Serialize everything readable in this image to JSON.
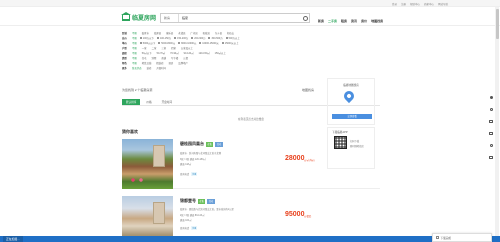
{
  "topbar": {
    "links": [
      "登录",
      "注册",
      "帮助中心",
      "商家中心",
      "网站导航"
    ]
  },
  "header": {
    "logo_text": "临夏房网",
    "search": {
      "scope": "新房",
      "query": "临夏"
    },
    "nav": [
      "新房",
      "二手房",
      "租房",
      "资讯",
      "房价",
      "地图找房"
    ],
    "nav_active": 1
  },
  "filters": {
    "rows": [
      {
        "label": "区域",
        "options": [
          "不限",
          "临夏市",
          "临夏县",
          "康乐县",
          "永靖县",
          "广河县",
          "和政县",
          "东乡县",
          "积石山"
        ]
      },
      {
        "label": "总价",
        "options": [
          "不限",
          "100万以下",
          "100-150万",
          "150-200万",
          "200-300万",
          "300-500万",
          "500万以上"
        ]
      },
      {
        "label": "单价",
        "options": [
          "不限",
          "5000元以下",
          "5000-8000元",
          "8000-10000元",
          "10000-15000元",
          "15000元以上"
        ]
      },
      {
        "label": "户型",
        "options": [
          "不限",
          "一室",
          "二室",
          "三室",
          "四室",
          "五室及以上"
        ]
      },
      {
        "label": "面积",
        "options": [
          "不限",
          "50㎡以下",
          "50-70㎡",
          "70-90㎡",
          "90-120㎡",
          "120-150㎡",
          "150㎡以上"
        ]
      },
      {
        "label": "类型",
        "options": [
          "不限",
          "住宅",
          "别墅",
          "商铺",
          "写字楼",
          "公寓"
        ]
      },
      {
        "label": "特色",
        "options": [
          "不限",
          "地铁沿线",
          "精装修",
          "现房",
          "品牌地产"
        ]
      },
      {
        "label": "更多",
        "options": [
          "售卖状态",
          "装修",
          "开盘时间"
        ]
      }
    ]
  },
  "results": {
    "text": "为您找到 2 个临夏房源",
    "view_switch": "地图找房"
  },
  "tabs": [
    "默认排序",
    "价格",
    "开盘时间"
  ],
  "compare_tip": "在列表页点击对比楼盘",
  "section_title": "猜你喜欢",
  "listings": [
    {
      "name": "碧桂园凤凰台",
      "badges": [
        "在售",
        "住宅"
      ],
      "address": "临夏市 · 滨河南路与北环路交汇处东北侧",
      "layout": "3居 / 4居 建面 120-180㎡",
      "area": "建面 118㎡",
      "price": "28000",
      "price_unit": "元/㎡(均价)",
      "agent": "咨询电话",
      "tag": "优惠"
    },
    {
      "name": "锦都壹号",
      "badges": [
        "在售",
        "住宅"
      ],
      "address": "临夏市 · 团结路与北滨河路交汇处，距市政府约2公里",
      "layout": "2居 / 3居 建面 89-143㎡",
      "area": "建面 100㎡",
      "price": "95000",
      "price_unit": "元/套起",
      "agent": "咨询电话",
      "tag": "优惠"
    }
  ],
  "map_panel": {
    "title": "临夏地图找房",
    "button": "立即查看"
  },
  "app_panel": {
    "title": "下载临夏APP",
    "line1": "扫码下载",
    "line2": "随时随地找房"
  },
  "statusbar": {
    "text": "正在加载..."
  },
  "popup": {
    "text": "下载完成"
  },
  "colors": {
    "brand_green": "#2ea55d",
    "price_red": "#e8421e",
    "status_blue": "#1f6fc6"
  }
}
